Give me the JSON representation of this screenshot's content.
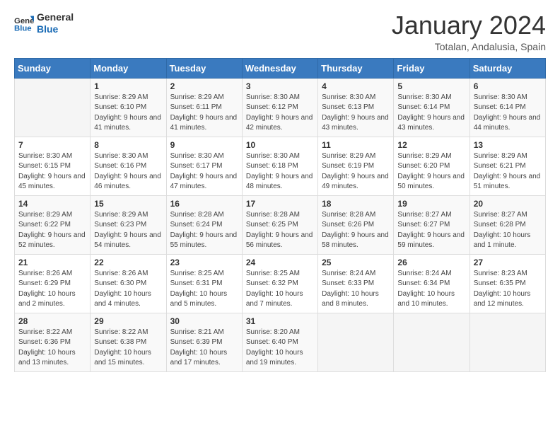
{
  "logo": {
    "text_general": "General",
    "text_blue": "Blue"
  },
  "header": {
    "month": "January 2024",
    "location": "Totalan, Andalusia, Spain"
  },
  "weekdays": [
    "Sunday",
    "Monday",
    "Tuesday",
    "Wednesday",
    "Thursday",
    "Friday",
    "Saturday"
  ],
  "weeks": [
    [
      {
        "day": "",
        "sunrise": "",
        "sunset": "",
        "daylight": ""
      },
      {
        "day": "1",
        "sunrise": "Sunrise: 8:29 AM",
        "sunset": "Sunset: 6:10 PM",
        "daylight": "Daylight: 9 hours and 41 minutes."
      },
      {
        "day": "2",
        "sunrise": "Sunrise: 8:29 AM",
        "sunset": "Sunset: 6:11 PM",
        "daylight": "Daylight: 9 hours and 41 minutes."
      },
      {
        "day": "3",
        "sunrise": "Sunrise: 8:30 AM",
        "sunset": "Sunset: 6:12 PM",
        "daylight": "Daylight: 9 hours and 42 minutes."
      },
      {
        "day": "4",
        "sunrise": "Sunrise: 8:30 AM",
        "sunset": "Sunset: 6:13 PM",
        "daylight": "Daylight: 9 hours and 43 minutes."
      },
      {
        "day": "5",
        "sunrise": "Sunrise: 8:30 AM",
        "sunset": "Sunset: 6:14 PM",
        "daylight": "Daylight: 9 hours and 43 minutes."
      },
      {
        "day": "6",
        "sunrise": "Sunrise: 8:30 AM",
        "sunset": "Sunset: 6:14 PM",
        "daylight": "Daylight: 9 hours and 44 minutes."
      }
    ],
    [
      {
        "day": "7",
        "sunrise": "Sunrise: 8:30 AM",
        "sunset": "Sunset: 6:15 PM",
        "daylight": "Daylight: 9 hours and 45 minutes."
      },
      {
        "day": "8",
        "sunrise": "Sunrise: 8:30 AM",
        "sunset": "Sunset: 6:16 PM",
        "daylight": "Daylight: 9 hours and 46 minutes."
      },
      {
        "day": "9",
        "sunrise": "Sunrise: 8:30 AM",
        "sunset": "Sunset: 6:17 PM",
        "daylight": "Daylight: 9 hours and 47 minutes."
      },
      {
        "day": "10",
        "sunrise": "Sunrise: 8:30 AM",
        "sunset": "Sunset: 6:18 PM",
        "daylight": "Daylight: 9 hours and 48 minutes."
      },
      {
        "day": "11",
        "sunrise": "Sunrise: 8:29 AM",
        "sunset": "Sunset: 6:19 PM",
        "daylight": "Daylight: 9 hours and 49 minutes."
      },
      {
        "day": "12",
        "sunrise": "Sunrise: 8:29 AM",
        "sunset": "Sunset: 6:20 PM",
        "daylight": "Daylight: 9 hours and 50 minutes."
      },
      {
        "day": "13",
        "sunrise": "Sunrise: 8:29 AM",
        "sunset": "Sunset: 6:21 PM",
        "daylight": "Daylight: 9 hours and 51 minutes."
      }
    ],
    [
      {
        "day": "14",
        "sunrise": "Sunrise: 8:29 AM",
        "sunset": "Sunset: 6:22 PM",
        "daylight": "Daylight: 9 hours and 52 minutes."
      },
      {
        "day": "15",
        "sunrise": "Sunrise: 8:29 AM",
        "sunset": "Sunset: 6:23 PM",
        "daylight": "Daylight: 9 hours and 54 minutes."
      },
      {
        "day": "16",
        "sunrise": "Sunrise: 8:28 AM",
        "sunset": "Sunset: 6:24 PM",
        "daylight": "Daylight: 9 hours and 55 minutes."
      },
      {
        "day": "17",
        "sunrise": "Sunrise: 8:28 AM",
        "sunset": "Sunset: 6:25 PM",
        "daylight": "Daylight: 9 hours and 56 minutes."
      },
      {
        "day": "18",
        "sunrise": "Sunrise: 8:28 AM",
        "sunset": "Sunset: 6:26 PM",
        "daylight": "Daylight: 9 hours and 58 minutes."
      },
      {
        "day": "19",
        "sunrise": "Sunrise: 8:27 AM",
        "sunset": "Sunset: 6:27 PM",
        "daylight": "Daylight: 9 hours and 59 minutes."
      },
      {
        "day": "20",
        "sunrise": "Sunrise: 8:27 AM",
        "sunset": "Sunset: 6:28 PM",
        "daylight": "Daylight: 10 hours and 1 minute."
      }
    ],
    [
      {
        "day": "21",
        "sunrise": "Sunrise: 8:26 AM",
        "sunset": "Sunset: 6:29 PM",
        "daylight": "Daylight: 10 hours and 2 minutes."
      },
      {
        "day": "22",
        "sunrise": "Sunrise: 8:26 AM",
        "sunset": "Sunset: 6:30 PM",
        "daylight": "Daylight: 10 hours and 4 minutes."
      },
      {
        "day": "23",
        "sunrise": "Sunrise: 8:25 AM",
        "sunset": "Sunset: 6:31 PM",
        "daylight": "Daylight: 10 hours and 5 minutes."
      },
      {
        "day": "24",
        "sunrise": "Sunrise: 8:25 AM",
        "sunset": "Sunset: 6:32 PM",
        "daylight": "Daylight: 10 hours and 7 minutes."
      },
      {
        "day": "25",
        "sunrise": "Sunrise: 8:24 AM",
        "sunset": "Sunset: 6:33 PM",
        "daylight": "Daylight: 10 hours and 8 minutes."
      },
      {
        "day": "26",
        "sunrise": "Sunrise: 8:24 AM",
        "sunset": "Sunset: 6:34 PM",
        "daylight": "Daylight: 10 hours and 10 minutes."
      },
      {
        "day": "27",
        "sunrise": "Sunrise: 8:23 AM",
        "sunset": "Sunset: 6:35 PM",
        "daylight": "Daylight: 10 hours and 12 minutes."
      }
    ],
    [
      {
        "day": "28",
        "sunrise": "Sunrise: 8:22 AM",
        "sunset": "Sunset: 6:36 PM",
        "daylight": "Daylight: 10 hours and 13 minutes."
      },
      {
        "day": "29",
        "sunrise": "Sunrise: 8:22 AM",
        "sunset": "Sunset: 6:38 PM",
        "daylight": "Daylight: 10 hours and 15 minutes."
      },
      {
        "day": "30",
        "sunrise": "Sunrise: 8:21 AM",
        "sunset": "Sunset: 6:39 PM",
        "daylight": "Daylight: 10 hours and 17 minutes."
      },
      {
        "day": "31",
        "sunrise": "Sunrise: 8:20 AM",
        "sunset": "Sunset: 6:40 PM",
        "daylight": "Daylight: 10 hours and 19 minutes."
      },
      {
        "day": "",
        "sunrise": "",
        "sunset": "",
        "daylight": ""
      },
      {
        "day": "",
        "sunrise": "",
        "sunset": "",
        "daylight": ""
      },
      {
        "day": "",
        "sunrise": "",
        "sunset": "",
        "daylight": ""
      }
    ]
  ]
}
